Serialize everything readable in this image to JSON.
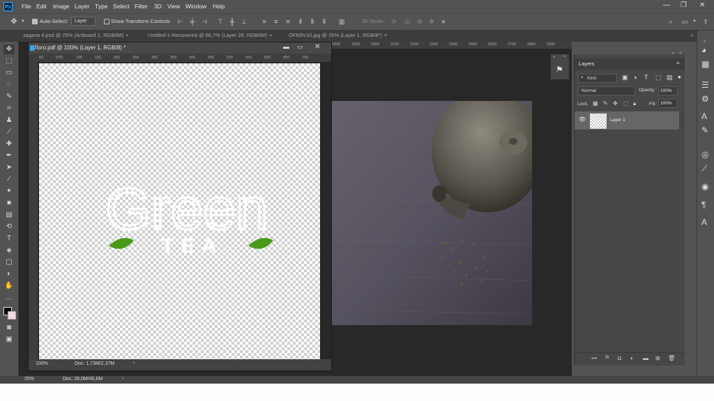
{
  "menubar": {
    "items": [
      "File",
      "Edit",
      "Image",
      "Layer",
      "Type",
      "Select",
      "Filter",
      "3D",
      "View",
      "Window",
      "Help"
    ]
  },
  "options": {
    "auto_select_label": "Auto-Select:",
    "auto_select_value": "Layer",
    "transform_label": "Show Transform Controls",
    "mode_label": "3D Mode:"
  },
  "tabs": [
    {
      "label": "задача 4.psd @ 25% (Artboard 1, RGB/8#)"
    },
    {
      "label": "Untitled-1-Recovered @ 66,7% (Layer 26, RGB/8#)"
    },
    {
      "label": "OFN9V10.jpg @ 25% (Layer 1, RGB/8*)"
    }
  ],
  "document": {
    "title": "Лого.pdf @ 100% (Layer 1, RGB/8) *",
    "zoom": "100%",
    "doc_size": "Doc: 1,73M/2,37M",
    "ruler_top": [
      "50",
      "0",
      "50",
      "100",
      "150",
      "200",
      "250",
      "300",
      "350",
      "400",
      "450",
      "500",
      "550",
      "600",
      "650",
      "700",
      "750",
      "800"
    ],
    "ruler_right": [
      "1800",
      "1900",
      "2000",
      "2100",
      "2200",
      "2300",
      "2400",
      "2500",
      "2600",
      "2700",
      "2800",
      "2900",
      "3000",
      "3100",
      "3200",
      "3300",
      "3400",
      "3500"
    ],
    "logo_word": "Green",
    "logo_sub": "TEA"
  },
  "layers_panel": {
    "title": "Layers",
    "filter_kind": "Kind",
    "blend_mode": "Normal",
    "opacity_label": "Opacity:",
    "opacity_value": "100%",
    "lock_label": "Lock:",
    "fill_label": "Fill:",
    "fill_value": "100%",
    "layers": [
      {
        "name": "Layer 1"
      }
    ]
  },
  "status": {
    "zoom": "25%",
    "doc_size": "Doc: 26,0M/40,6M"
  },
  "colors": {
    "accent": "#31a8ff",
    "leaf": "#4a9a1a",
    "panel": "#474747",
    "background": "#535353"
  }
}
